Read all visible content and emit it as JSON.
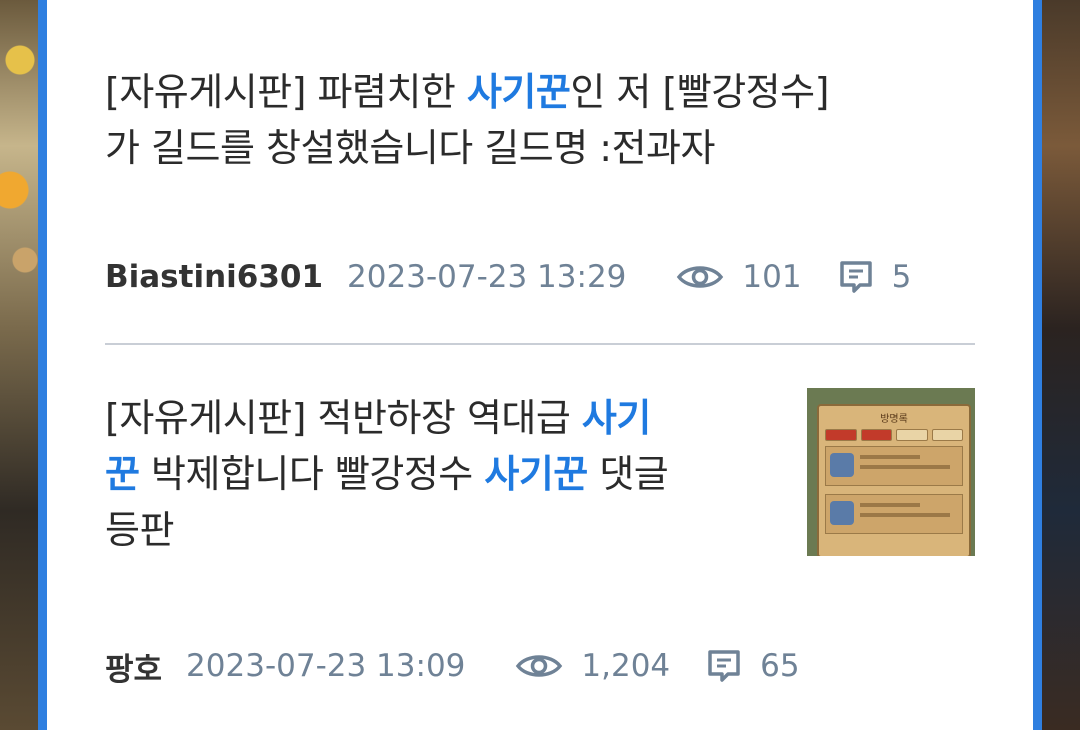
{
  "posts": [
    {
      "title_parts": [
        "[자유게시판] 파렴치한 ",
        "사기꾼",
        "인 저 [빨강정수]",
        "가 길드를 창설했습니다 길드명 :전과자"
      ],
      "author": "Biastini6301",
      "date": "2023-07-23 13:29",
      "views": "101",
      "comments": "5"
    },
    {
      "title_parts": [
        "[자유게시판] 적반하장 역대급 ",
        "사기",
        "꾼",
        " 박제합니다 빨강정수 ",
        "사기꾼",
        " 댓글",
        "등판"
      ],
      "author": "팡호",
      "date": "2023-07-23 13:09",
      "views": "1,204",
      "comments": "65",
      "thumbnail": {
        "title": "방명록"
      }
    }
  ],
  "colors": {
    "accent": "#1f7ae0",
    "frame": "#2f7fe0",
    "meta": "#6f8296"
  },
  "icons": {
    "views": "eye-icon",
    "comments": "comment-icon"
  }
}
